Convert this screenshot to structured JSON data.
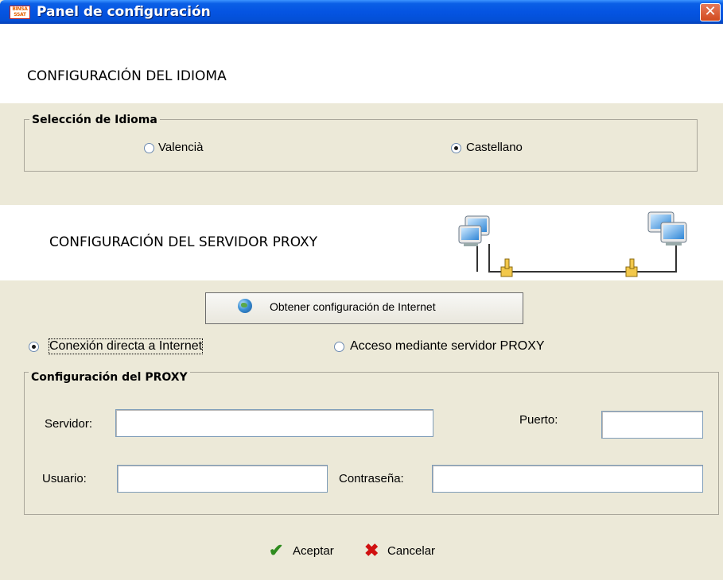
{
  "window": {
    "title": "Panel de configuración",
    "close_glyph": "✕",
    "icon_text_1": "BINSA",
    "icon_text_2": "SSAT"
  },
  "language_section": {
    "heading": "CONFIGURACIÓN DEL IDIOMA",
    "group_title": "Selección de Idioma",
    "options": [
      {
        "label": "Valencià",
        "selected": false
      },
      {
        "label": "Castellano",
        "selected": true
      }
    ]
  },
  "proxy_section": {
    "heading": "CONFIGURACIÓN DEL SERVIDOR PROXY",
    "network_image": "network-computers-icon",
    "obtain_button": {
      "label": "Obtener configuración de Internet",
      "icon": "globe-icon"
    },
    "connection_options": [
      {
        "label": "Conexión directa a Internet",
        "selected": true
      },
      {
        "label": "Acceso mediante servidor PROXY",
        "selected": false
      }
    ],
    "group_title": "Configuración del PROXY",
    "fields": {
      "server": {
        "label": "Servidor:",
        "value": ""
      },
      "port": {
        "label": "Puerto:",
        "value": ""
      },
      "user": {
        "label": "Usuario:",
        "value": ""
      },
      "password": {
        "label": "Contraseña:",
        "value": ""
      }
    }
  },
  "actions": {
    "accept": {
      "label": "Aceptar",
      "icon": "checkmark-icon",
      "color": "#2e8b1e"
    },
    "cancel": {
      "label": "Cancelar",
      "icon": "red-x-icon",
      "color": "#d01010"
    }
  },
  "colors": {
    "titlebar": "#0554e2",
    "window_bg": "#ece9d8",
    "close_button": "#d14a1e"
  }
}
